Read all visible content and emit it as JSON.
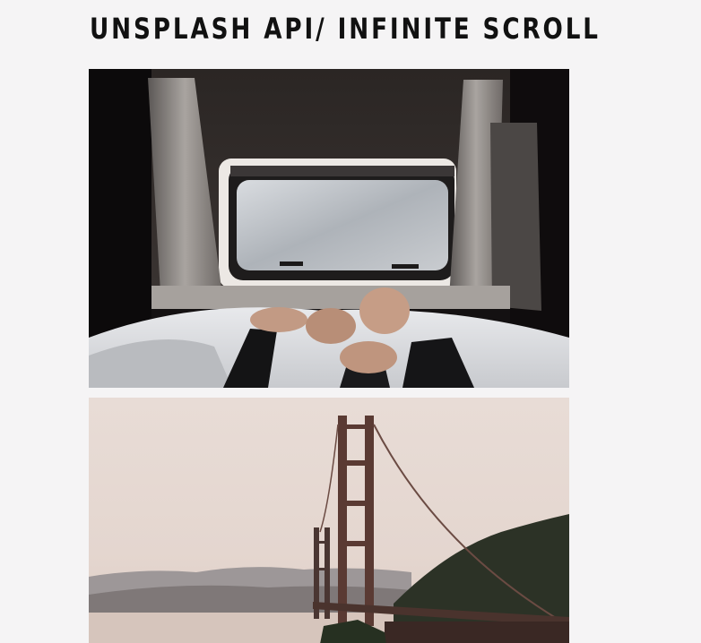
{
  "header": {
    "title": "UNSPLASH API/ INFINITE SCROLL"
  },
  "feed": {
    "photos": [
      {
        "subject": "camper-window-feet-photo"
      },
      {
        "subject": "golden-gate-bridge-photo"
      }
    ]
  },
  "colors": {
    "background": "#f5f4f5",
    "title_text": "#111111"
  }
}
